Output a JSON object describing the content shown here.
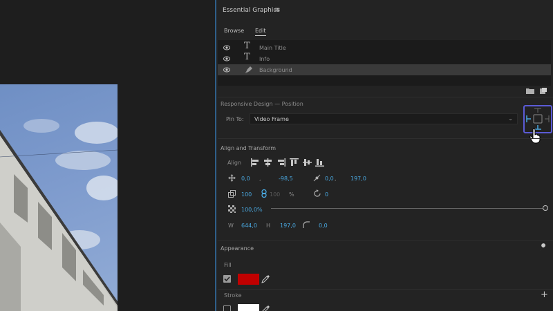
{
  "panel": {
    "title": "Essential Graphics",
    "menu_glyph": "≡"
  },
  "tabs": [
    {
      "label": "Browse"
    },
    {
      "label": "Edit"
    }
  ],
  "layers": [
    {
      "name": "Main Title",
      "type_glyph": "T",
      "selected": false
    },
    {
      "name": "Info",
      "type_glyph": "T",
      "selected": false
    },
    {
      "name": "Background",
      "type_glyph": "pen",
      "selected": true
    }
  ],
  "responsive": {
    "title": "Responsive Design — Position",
    "pin_label": "Pin To:",
    "pin_value": "Video Frame",
    "chevron": "⌄"
  },
  "align_transform": {
    "title": "Align and Transform",
    "align_label": "Align",
    "position": {
      "x": "0,0",
      "sep": ",",
      "y": "-98,5"
    },
    "anchor": {
      "x": "0,0",
      "sep": ",",
      "y": "197,0"
    },
    "scale": {
      "w": "100",
      "h": "100",
      "unit": "%"
    },
    "rotation": "0",
    "opacity": {
      "value": "100,0",
      "unit": "%",
      "level": 1.0
    },
    "size": {
      "w_label": "W",
      "w": "644,0",
      "h_label": "H",
      "h": "197,0",
      "corner": "0,0"
    }
  },
  "appearance": {
    "title": "Appearance",
    "fill_label": "Fill",
    "fill_color": "#c00000",
    "fill_checked": true,
    "stroke_label": "Stroke",
    "stroke_add": "+",
    "stroke_color": "#ffffff",
    "stroke_checked": false
  },
  "colors": {
    "accent": "#4aa8e0",
    "highlight": "#5b5bd6",
    "panel_bg": "#232323"
  }
}
